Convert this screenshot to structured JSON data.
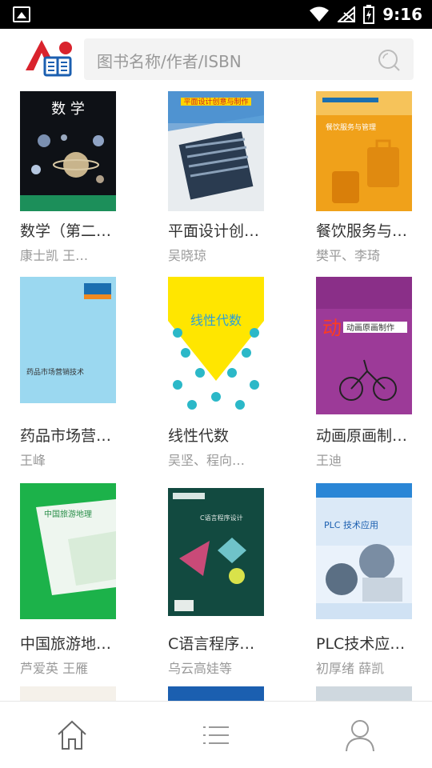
{
  "status": {
    "time": "9:16"
  },
  "search": {
    "placeholder": "图书名称/作者/ISBN"
  },
  "books": [
    {
      "title": "数学（第二…",
      "author": "康士凯 王…",
      "cover_text": "数 学"
    },
    {
      "title": "平面设计创…",
      "author": "吴晓琼",
      "cover_text": "平面设计创意与制作"
    },
    {
      "title": "餐饮服务与…",
      "author": "樊平、李琦",
      "cover_text": "餐饮服务与管理"
    },
    {
      "title": "药品市场营…",
      "author": "王峰",
      "cover_text": "药品市场营销技术"
    },
    {
      "title": "线性代数",
      "author": "吴坚、程向…",
      "cover_text": "线性代数"
    },
    {
      "title": "动画原画制…",
      "author": "王迪",
      "cover_text": "动画原画制作"
    },
    {
      "title": "中国旅游地…",
      "author": "芦爱英 王雁",
      "cover_text": "中国旅游地理"
    },
    {
      "title": "C语言程序…",
      "author": "乌云高娃等",
      "cover_text": "C语言程序设计"
    },
    {
      "title": "PLC技术应…",
      "author": "初厚绪 薛凯",
      "cover_text": "PLC 技术应用"
    }
  ],
  "nav": {
    "items": [
      "home-icon",
      "list-icon",
      "user-icon"
    ]
  }
}
